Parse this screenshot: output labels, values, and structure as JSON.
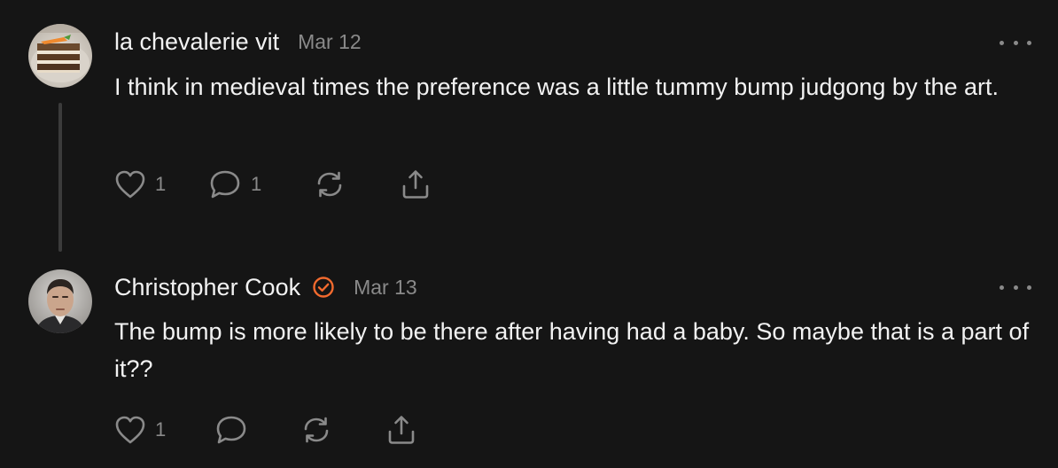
{
  "comments": [
    {
      "author": "la chevalerie vit",
      "date": "Mar 12",
      "verified": false,
      "text": "I think in medieval times the preference was a little tummy bump judgong by the art.",
      "likes": "1",
      "replies": "1"
    },
    {
      "author": "Christopher Cook",
      "date": "Mar 13",
      "verified": true,
      "text": "The bump is more likely to be there after having had a baby. So maybe that is a part of it??",
      "likes": "1",
      "replies": ""
    }
  ],
  "colors": {
    "background": "#151515",
    "text": "#f2f2f2",
    "muted": "#8a8a8a",
    "verified_accent": "#f26a2e"
  },
  "icons": {
    "like": "heart-icon",
    "reply": "chat-bubble-icon",
    "repost": "repost-icon",
    "share": "share-icon",
    "more": "more-horizontal-icon",
    "verified": "verified-check-icon"
  }
}
